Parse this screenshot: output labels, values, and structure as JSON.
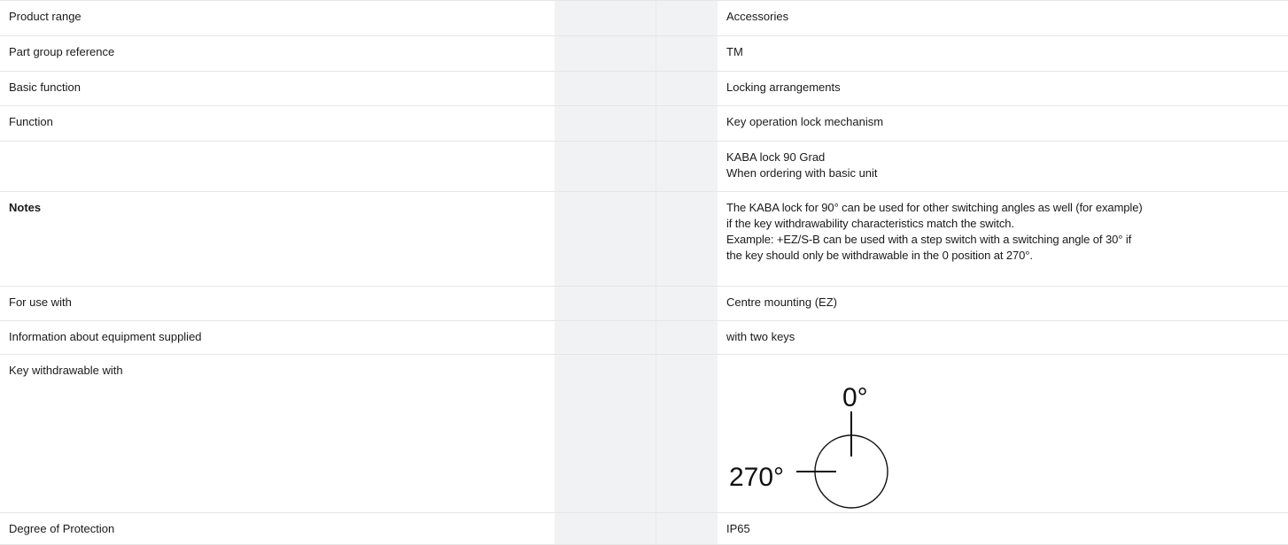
{
  "rows": [
    {
      "label": "Product range",
      "value": "Accessories"
    },
    {
      "label": "Part group reference",
      "value": "TM"
    },
    {
      "label": "Basic function",
      "value": "Locking arrangements"
    },
    {
      "label": "Function",
      "value": "Key operation lock mechanism"
    },
    {
      "label": "",
      "value_lines": [
        "KABA lock 90 Grad",
        "When ordering with basic unit"
      ]
    },
    {
      "label": "Notes",
      "value_lines": [
        "The KABA lock for 90° can be used for other switching angles as well (for example)",
        "if the key withdrawability characteristics match the switch.",
        "Example: +EZ/S-B can be used with a step switch with a switching angle of 30° if",
        "the key should only be withdrawable in the 0 position at 270°."
      ]
    },
    {
      "label": "For use with",
      "value": "Centre mounting (EZ)"
    },
    {
      "label": "Information about equipment supplied",
      "value": "with two keys"
    },
    {
      "label": "Key withdrawable with",
      "diagram": {
        "top_label": "0°",
        "left_label": "270°"
      }
    },
    {
      "label": "Degree of Protection",
      "value": "IP65"
    }
  ]
}
